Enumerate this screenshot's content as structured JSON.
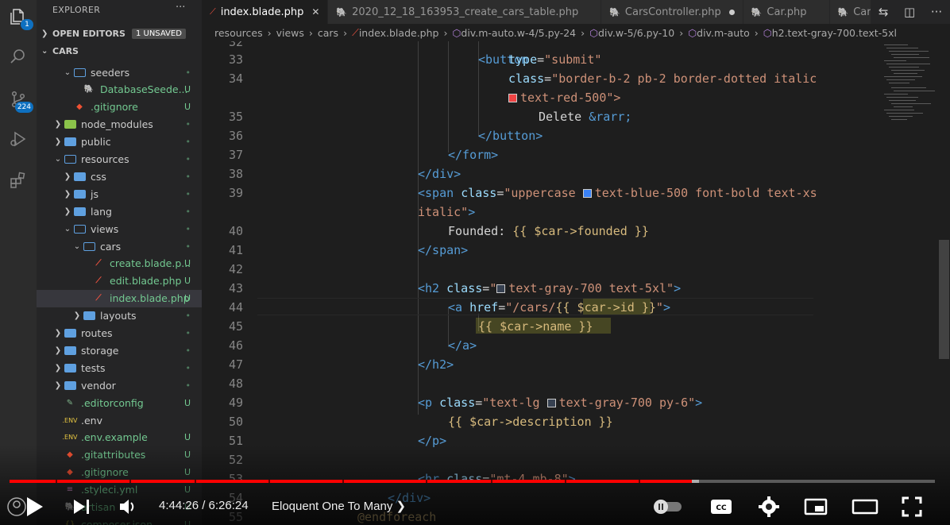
{
  "activity_bar": {
    "explorer_badge": "1",
    "scm_badge": "224"
  },
  "sidebar": {
    "title": "EXPLORER",
    "more": "···",
    "open_editors_label": "OPEN EDITORS",
    "open_editors_badge": "1 UNSAVED",
    "project_label": "CARS",
    "tree": [
      {
        "label": "seeders",
        "type": "folder-open",
        "depth": 2,
        "status": "•"
      },
      {
        "label": "DatabaseSeede...",
        "type": "php",
        "depth": 3,
        "status": "U"
      },
      {
        "label": ".gitignore",
        "type": "git",
        "depth": 2,
        "status": "U"
      },
      {
        "label": "node_modules",
        "type": "folder-node",
        "depth": 1,
        "status": "•"
      },
      {
        "label": "public",
        "type": "folder",
        "depth": 1,
        "status": "•"
      },
      {
        "label": "resources",
        "type": "folder-open",
        "depth": 1,
        "status": "•"
      },
      {
        "label": "css",
        "type": "folder",
        "depth": 2,
        "status": "•"
      },
      {
        "label": "js",
        "type": "folder",
        "depth": 2,
        "status": "•"
      },
      {
        "label": "lang",
        "type": "folder",
        "depth": 2,
        "status": "•"
      },
      {
        "label": "views",
        "type": "folder-open",
        "depth": 2,
        "status": "•"
      },
      {
        "label": "cars",
        "type": "folder-open",
        "depth": 3,
        "status": "•"
      },
      {
        "label": "create.blade.p...",
        "type": "blade",
        "depth": 4,
        "status": "U"
      },
      {
        "label": "edit.blade.php",
        "type": "blade",
        "depth": 4,
        "status": "U"
      },
      {
        "label": "index.blade.php",
        "type": "blade",
        "depth": 4,
        "status": "U"
      },
      {
        "label": "layouts",
        "type": "folder",
        "depth": 3,
        "status": "•"
      },
      {
        "label": "routes",
        "type": "folder",
        "depth": 1,
        "status": "•"
      },
      {
        "label": "storage",
        "type": "folder",
        "depth": 1,
        "status": "•"
      },
      {
        "label": "tests",
        "type": "folder",
        "depth": 1,
        "status": "•"
      },
      {
        "label": "vendor",
        "type": "folder",
        "depth": 1,
        "status": "•"
      },
      {
        "label": ".editorconfig",
        "type": "editorconfig",
        "depth": 1,
        "status": "U"
      },
      {
        "label": ".env",
        "type": "env",
        "depth": 1,
        "status": ""
      },
      {
        "label": ".env.example",
        "type": "env",
        "depth": 1,
        "status": "U"
      },
      {
        "label": ".gitattributes",
        "type": "git",
        "depth": 1,
        "status": "U"
      },
      {
        "label": ".gitignore",
        "type": "git",
        "depth": 1,
        "status": "U"
      },
      {
        "label": ".styleci.yml",
        "type": "yml",
        "depth": 1,
        "status": "U"
      },
      {
        "label": "artisan",
        "type": "php",
        "depth": 1,
        "status": "U"
      },
      {
        "label": "composer.json",
        "type": "json",
        "depth": 1,
        "status": "U"
      }
    ]
  },
  "tabs": [
    {
      "label": "index.blade.php",
      "active": true,
      "icon": "blade",
      "trail": "close"
    },
    {
      "label": "2020_12_18_163953_create_cars_table.php",
      "active": false,
      "icon": "php",
      "trail": ""
    },
    {
      "label": "CarsController.php",
      "active": false,
      "icon": "php",
      "trail": "dot"
    },
    {
      "label": "Car.php",
      "active": false,
      "icon": "php",
      "trail": ""
    },
    {
      "label": "CarMod",
      "active": false,
      "icon": "php",
      "trail": ""
    }
  ],
  "breadcrumb": [
    "resources",
    "views",
    "cars",
    "index.blade.php",
    "div.m-auto.w-4/5.py-24",
    "div.w-5/6.py-10",
    "div.m-auto",
    "h2.text-gray-700.text-5xl"
  ],
  "editor": {
    "line_numbers": [
      "32",
      "33",
      "34",
      "35",
      "36",
      "37",
      "38",
      "39",
      "40",
      "41",
      "42",
      "43",
      "44",
      "45",
      "46",
      "47",
      "48",
      "49",
      "50",
      "51",
      "52",
      "53",
      "54",
      "55"
    ],
    "code": {
      "l32": "<button",
      "l33_attr": "type",
      "l33_val": "\"submit\"",
      "l34_attr": "class",
      "l34_val": "\"border-b-2 pb-2 border-dotted italic",
      "l34b_val": "text-red-500\">",
      "l35_txt": "Delete ",
      "l35_ent": "&rarr;",
      "l36": "</button>",
      "l37": "</form>",
      "l38": "</div>",
      "l39_tag": "<span ",
      "l39_attr": "class",
      "l39_val": "\"uppercase ",
      "l39_val2": "text-blue-500 font-bold text-xs",
      "l39b_val": "italic\"",
      "l39b_close": ">",
      "l40_txt": "Founded: ",
      "l40_blade": "{{ $car->founded }}",
      "l41": "</span>",
      "l43_tag": "<h2 ",
      "l43_attr": "class",
      "l43_q": "\"",
      "l43_val": "text-gray-700 text-5xl\"",
      "l43_close": ">",
      "l44_tag": "<a ",
      "l44_attr": "href",
      "l44_val": "\"/cars/",
      "l44_blade": "{{ $car->id }}",
      "l44_end": "\"",
      "l44_close": ">",
      "l45_blade": "{{ $car->name }}",
      "l46": "</a>",
      "l47": "</h2>",
      "l49_tag": "<p ",
      "l49_attr": "class",
      "l49_val": "\"text-lg ",
      "l49_val2": "text-gray-700 py-6\"",
      "l49_close": ">",
      "l50_blade": "{{ $car->description }}",
      "l51": "</p>",
      "l53_tag": "<hr ",
      "l53_attr": "class",
      "l53_val": "\"mt-4 mb-8\"",
      "l53_close": ">",
      "l54": "</div>",
      "l55": "@endforeach"
    },
    "swatches": {
      "red": "#ef4444",
      "blue": "#3b82f6",
      "gray": "#374151"
    }
  },
  "player": {
    "time": "4:44:26 / 6:26:24",
    "chapter": "Eloquent One To Many",
    "progress": 0.737,
    "buffered": 0.745
  }
}
